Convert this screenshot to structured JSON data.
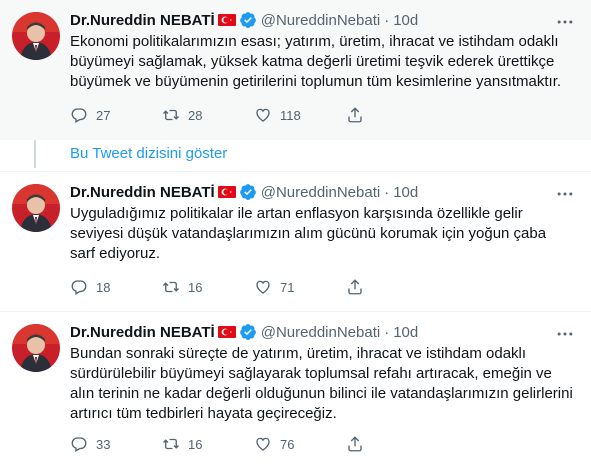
{
  "colors": {
    "link": "#1d9bf0",
    "secondary_text": "#536471",
    "verified": "#1d9bf0",
    "flag_red": "#e30a17"
  },
  "tweets": [
    {
      "display_name": "Dr.Nureddin NEBATİ",
      "handle": "@NureddinNebati",
      "separator": "·",
      "time": "10d",
      "text": "Ekonomi politikalarımızın esası; yatırım, üretim, ihracat ve istihdam odaklı büyümeyi sağlamak, yüksek katma değerli üretimi teşvik ederek ürettikçe büyümek ve büyümenin getirilerini toplumun tüm kesimlerine yansıtmaktır.",
      "replies": "27",
      "retweets": "28",
      "likes": "118",
      "icons": [
        "reply-icon",
        "retweet-icon",
        "like-icon",
        "share-icon"
      ]
    },
    {
      "display_name": "Dr.Nureddin NEBATİ",
      "handle": "@NureddinNebati",
      "separator": "·",
      "time": "10d",
      "text": "Uyguladığımız politikalar ile artan enflasyon karşısında özellikle gelir seviyesi düşük vatandaşlarımızın alım gücünü korumak için yoğun çaba sarf ediyoruz.",
      "replies": "18",
      "retweets": "16",
      "likes": "71",
      "icons": [
        "reply-icon",
        "retweet-icon",
        "like-icon",
        "share-icon"
      ]
    },
    {
      "display_name": "Dr.Nureddin NEBATİ",
      "handle": "@NureddinNebati",
      "separator": "·",
      "time": "10d",
      "text": "Bundan sonraki süreçte de yatırım, üretim, ihracat ve istihdam odaklı sürdürülebilir büyümeyi sağlayarak toplumsal refahı artıracak, emeğin ve alın terinin ne kadar değerli olduğunun bilinci ile vatandaşlarımızın gelirlerini artırıcı tüm tedbirleri hayata geçireceğiz.",
      "replies": "33",
      "retweets": "16",
      "likes": "76",
      "icons": [
        "reply-icon",
        "retweet-icon",
        "like-icon",
        "share-icon"
      ]
    }
  ],
  "thread": {
    "show_thread_label": "Bu Tweet dizisini göster"
  }
}
